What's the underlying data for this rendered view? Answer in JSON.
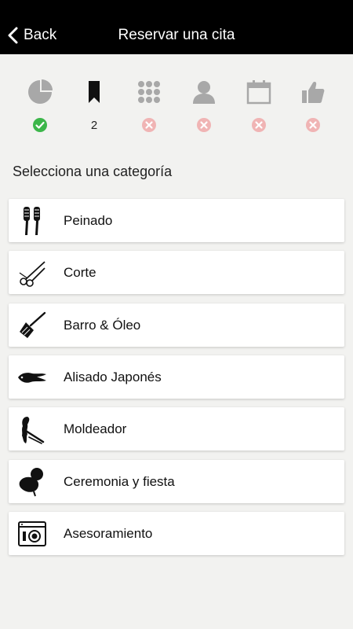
{
  "header": {
    "back_label": "Back",
    "title": "Reservar una cita"
  },
  "steps": [
    {
      "icon": "pie-chart-icon",
      "status": "done"
    },
    {
      "icon": "bookmark-icon",
      "status": "current",
      "number": "2"
    },
    {
      "icon": "grid-icon",
      "status": "pending"
    },
    {
      "icon": "person-icon",
      "status": "pending"
    },
    {
      "icon": "calendar-icon",
      "status": "pending"
    },
    {
      "icon": "thumbs-up-icon",
      "status": "pending"
    }
  ],
  "section_title": "Selecciona una categoría",
  "categories": [
    {
      "label": "Peinado",
      "icon": "hair-brushes-icon"
    },
    {
      "label": "Corte",
      "icon": "scissors-icon"
    },
    {
      "label": "Barro & Óleo",
      "icon": "dye-brush-icon"
    },
    {
      "label": "Alisado Japonés",
      "icon": "straight-hair-icon"
    },
    {
      "label": "Moldeador",
      "icon": "curling-iron-icon"
    },
    {
      "label": "Ceremonia y fiesta",
      "icon": "updo-hairstyle-icon"
    },
    {
      "label": "Asesoramiento",
      "icon": "consulting-screen-icon"
    }
  ],
  "colors": {
    "header_bg": "#000000",
    "page_bg": "#f2f2f0",
    "done": "#3cb64a",
    "pending": "#f0b4b4",
    "icon_gray": "#a8a8a8"
  }
}
